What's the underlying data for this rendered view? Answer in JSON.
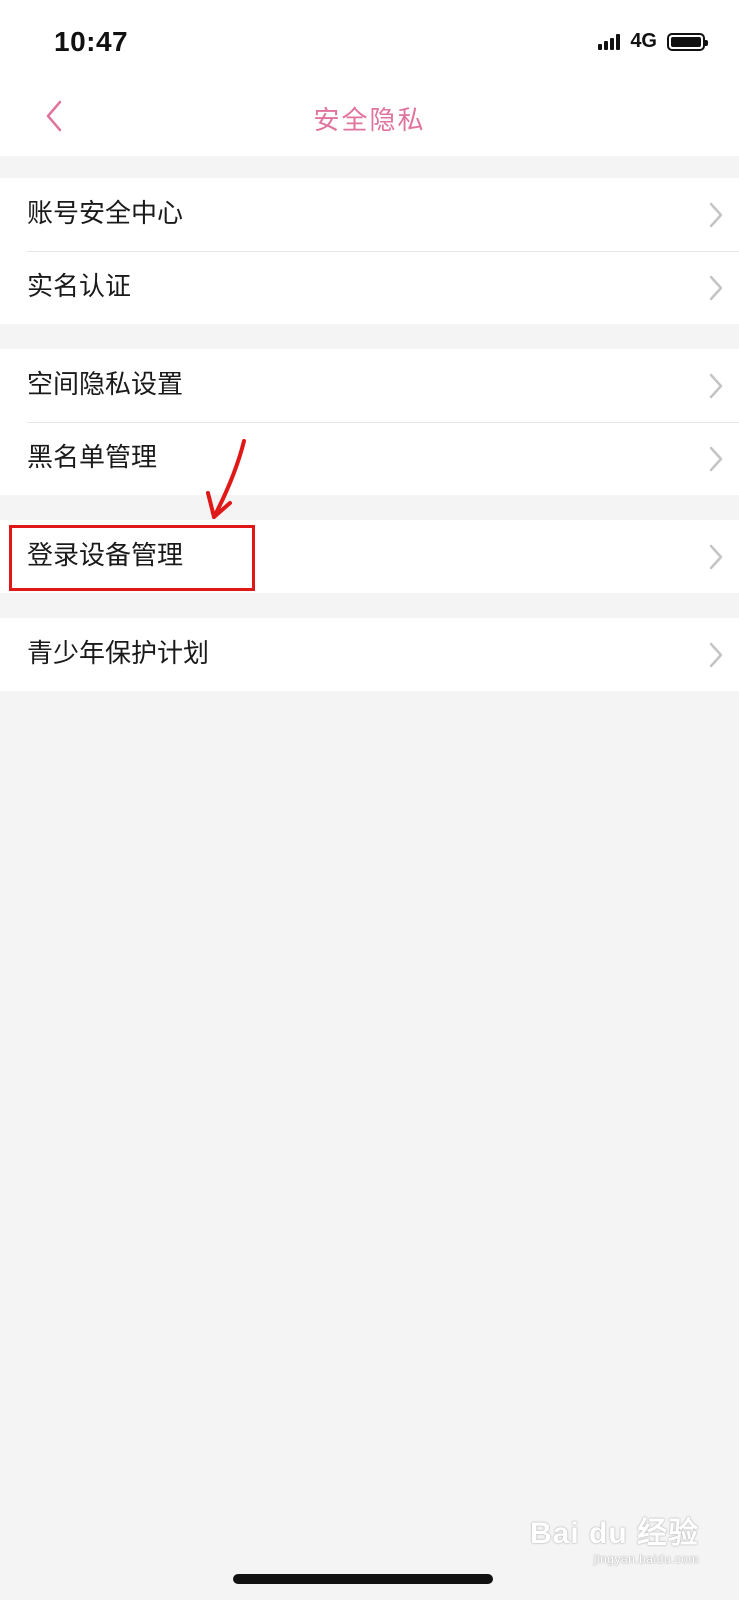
{
  "status_bar": {
    "time": "10:47",
    "network": "4G",
    "signal_icon": "signal-bars-icon",
    "battery_icon": "battery-full-icon"
  },
  "header": {
    "title": "安全隐私",
    "back_icon": "chevron-left-icon"
  },
  "groups": [
    {
      "items": [
        {
          "label": "账号安全中心"
        },
        {
          "label": "实名认证"
        }
      ]
    },
    {
      "items": [
        {
          "label": "空间隐私设置"
        },
        {
          "label": "黑名单管理"
        }
      ]
    },
    {
      "items": [
        {
          "label": "登录设备管理"
        }
      ]
    },
    {
      "items": [
        {
          "label": "青少年保护计划"
        }
      ]
    }
  ],
  "annotation": {
    "color": "#e01818",
    "highlighted_item": "登录设备管理"
  },
  "watermark": {
    "main": "Bai du 经验",
    "sub": "jingyan.baidu.com"
  },
  "colors": {
    "accent": "#e0749e",
    "background": "#f4f4f4",
    "surface": "#ffffff",
    "chevron": "#c4c4c4"
  }
}
